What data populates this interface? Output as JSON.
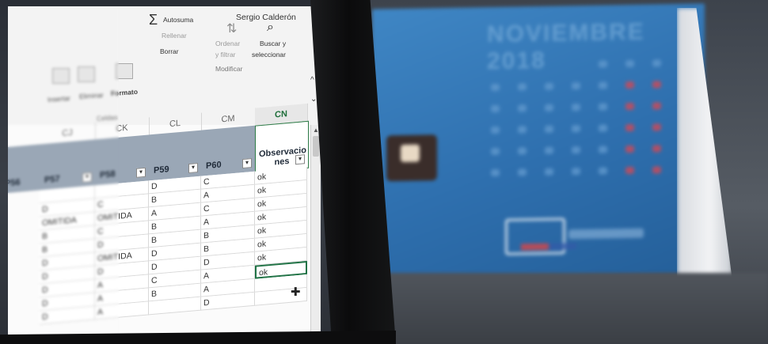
{
  "ribbon": {
    "user_name": "Sergio Calderón",
    "insertar": "Insertar",
    "eliminar": "Eliminar",
    "formato": "Formato",
    "celdas": "Celdas",
    "autosuma": "Autosuma",
    "rellenar": "Rellenar",
    "borrar": "Borrar",
    "ordenar": "Ordenar",
    "y_filtrar": "y filtrar",
    "buscar": "Buscar y",
    "seleccionar": "seleccionar",
    "modificar": "Modificar"
  },
  "sheet": {
    "column_letters": [
      "CJ",
      "CK",
      "CL",
      "CM",
      "CN"
    ],
    "headers": [
      "P57",
      "P58",
      "P59",
      "P60",
      "Observacio nes"
    ],
    "left_header_fragment": "P56",
    "rows": [
      [
        "",
        "",
        "D",
        "C",
        "ok"
      ],
      [
        "D",
        "C",
        "B",
        "A",
        "ok"
      ],
      [
        "OMITIDA",
        "OMITIDA",
        "A",
        "C",
        "ok"
      ],
      [
        "B",
        "C",
        "B",
        "A",
        "ok"
      ],
      [
        "B",
        "D",
        "B",
        "B",
        "ok"
      ],
      [
        "D",
        "OMITIDA",
        "D",
        "B",
        "ok"
      ],
      [
        "D",
        "D",
        "D",
        "D",
        "ok"
      ],
      [
        "D",
        "A",
        "C",
        "A",
        "ok"
      ],
      [
        "D",
        "A",
        "B",
        "A",
        ""
      ],
      [
        "D",
        "A",
        "",
        "D",
        ""
      ]
    ]
  },
  "calendar": {
    "month_title": "NOVIEMBRE 2018"
  }
}
